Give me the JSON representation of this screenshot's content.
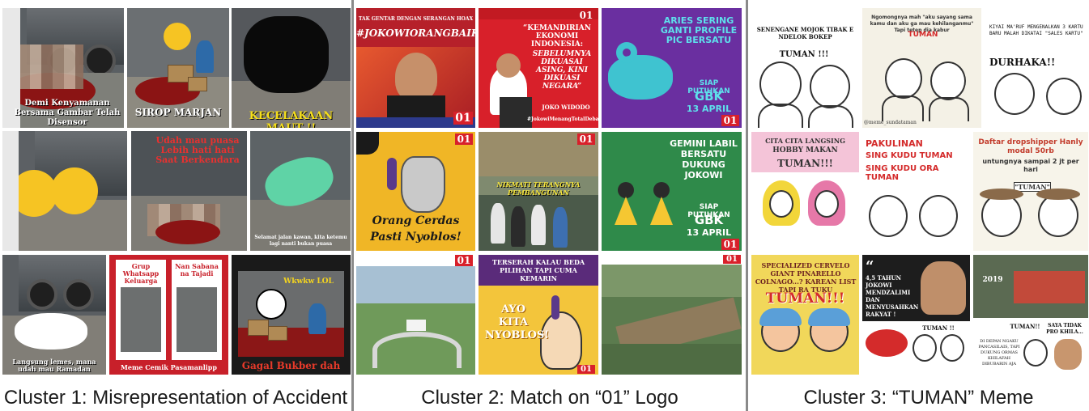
{
  "clusters": [
    {
      "caption": "Cluster 1: Misrepresentation of Accident",
      "tiles": {
        "t1": "Demi Kenyamanan Bersama Gambar Telah Disensor",
        "t2": "SIROP MARJAN",
        "t3": "KECELAKAAN MAUT !!",
        "t5a": "Udah mau puasa",
        "t5b": "Lebih hati hati",
        "t5c": "Saat Berkendara",
        "t6": "Selamat jalan kawan, kita ketemu lagi nanti bukan puasa",
        "t7": "Langsung lemes, mana udah mau Ramadan",
        "t8a": "Grup Whatsapp Keluarga",
        "t8b": "Nan Sabana na Tajadi",
        "t8c": "Meme Cemik Pasamanlipp",
        "t9a": "Wkwkw LOL",
        "t9b": "Gagal Bukber dah"
      }
    },
    {
      "caption": "Cluster 2: Match on “01” Logo",
      "tiles": {
        "t1a": "TAK GENTAR DENGAN SERANGAN HOAX",
        "t1b": "#JOKOWIORANGBAIK",
        "t2a": "“KEMANDIRIAN EKONOMI INDONESIA:",
        "t2b": "SEBELUMNYA DIKUASAI ASING, KINI DIKUASI NEGARA”",
        "t2c": "JOKO WIDODO",
        "t2d": "#JokowiMenangTotalDebat",
        "t3a": "ARIES SERING GANTI PROFILE PIC BERSATU",
        "t3b": "SIAP PUTIHKAN",
        "t3c": "GBK",
        "t3d": "13 APRIL",
        "t4a": "Orang Cerdas",
        "t4b": "Pasti Nyoblos!",
        "t5": "NIKMATI TERANGNYA PEMBANGUNAN",
        "t6a": "GEMINI LABIL BERSATU DUKUNG JOKOWI",
        "t8a": "TERSERAH KALAU BEDA PILIHAN TAPI CUMA KEMARIN",
        "t8b": "AYO KITA NYOBLOS!",
        "logo": "01"
      }
    },
    {
      "caption": "Cluster 3: “TUMAN” Meme",
      "tiles": {
        "t1a": "SENENGANE MOJOK TIBAK E NDELOK BOKEP",
        "t1b": "TUMAN !!!",
        "t2a": "Ngomongnya mah \"aku sayang sama kamu dan aku ga mau kehilanganmu\" Tapi tetep dia kabur",
        "t2b": "TUMAN",
        "t2c": "@meme_sundataman",
        "t3a": "KIYAI MA'RUF MENGENALKAN 3 KARTU BARU MALAH DIKATAI \"SALES KARTU\"",
        "t3b": "DURHAKA!!",
        "t4a": "CITA CITA LANGSING",
        "t4b": "HOBBY MAKAN",
        "t4c": "TUMAN!!!",
        "t5a": "PAKULINAN",
        "t5b": "SING KUDU TUMAN",
        "t5c": "SING KUDU ORA TUMAN",
        "t6a": "Daftar dropshipper Hanly modal 50rb",
        "t6b": "untungnya sampai 2 jt per hari",
        "t6c": "\"TUMAN\"",
        "t7a": "SPECIALIZED CERVELO GIANT PINARELLO COLNAGO...? KAREAN LIST TAPI RA TUKU",
        "t7b": "TUMAN!!!",
        "t8a": "4,5 TAHUN JOKOWI MENDZALIMI DAN MENYUSAHKAN RAKYAT !",
        "t8b": "TUMAN !!",
        "t9a": "2019",
        "t9b": "TUMAN!!",
        "t9c": "SAYA TIDAK PRO KHILA...",
        "t9d": "DI DEPAN NGAKU PANCASILAIS, TAPI DUKUNG ORMAS KHILAFAH DIBUBARIN AJA"
      }
    }
  ],
  "colors": {
    "c2_red": "#d8202a",
    "c2_purple": "#6a2fa0",
    "c2_green": "#2f8a4a",
    "c2_yellow": "#f0b626",
    "c3_cream": "#f4f1e6",
    "c3_red": "#d42b2b"
  }
}
